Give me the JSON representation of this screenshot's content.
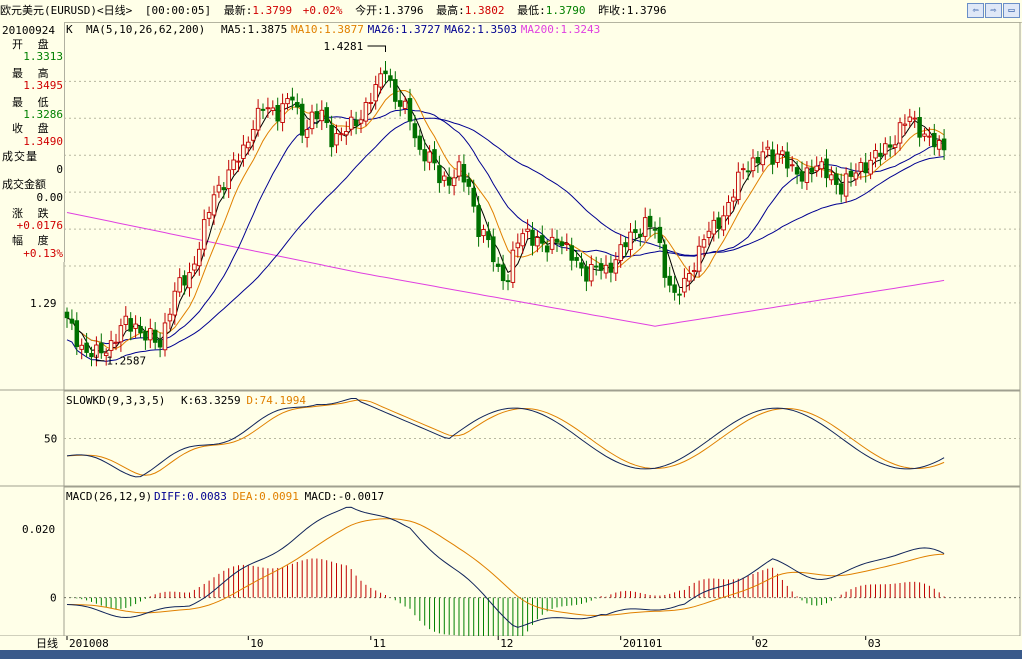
{
  "title": {
    "name": "欧元美元(EURUSD)<日线>",
    "time": "[00:00:05]",
    "latest_label": "最新:",
    "latest": "1.3799",
    "change": "+0.02%",
    "open_label": "今开:",
    "open": "1.3796",
    "high_label": "最高:",
    "high": "1.3802",
    "low_label": "最低:",
    "low": "1.3790",
    "prev_label": "昨收:",
    "prev": "1.3796"
  },
  "window_buttons": [
    "⇦",
    "⇨",
    "▭"
  ],
  "info_panel": {
    "date": "20100924",
    "items": [
      {
        "label": "开 盘",
        "value": "1.3313",
        "color": "#008000"
      },
      {
        "label": "最 高",
        "value": "1.3495",
        "color": "#d00000"
      },
      {
        "label": "最 低",
        "value": "1.3286",
        "color": "#008000"
      },
      {
        "label": "收 盘",
        "value": "1.3490",
        "color": "#d00000"
      },
      {
        "label": "成交量",
        "value": "0",
        "color": "#000000"
      },
      {
        "label": "成交金额",
        "value": "0.00",
        "color": "#000000"
      },
      {
        "label": "涨 跌",
        "value": "+0.0176",
        "color": "#d00000"
      },
      {
        "label": "幅 度",
        "value": "+0.13%",
        "color": "#d00000"
      }
    ]
  },
  "chart_data": [
    {
      "type": "candlestick",
      "legend": {
        "k": "K",
        "ma_params": "MA(5,10,26,62,200)",
        "entries": [
          {
            "name": "MA5",
            "text": "MA5:1.3875",
            "color": "#000000"
          },
          {
            "name": "MA10",
            "text": "MA10:1.3877",
            "color": "#e08000"
          },
          {
            "name": "MA26",
            "text": "MA26:1.3727",
            "color": "#000090"
          },
          {
            "name": "MA62",
            "text": "MA62:1.3503",
            "color": "#000090"
          },
          {
            "name": "MA200",
            "text": "MA200:1.3243",
            "color": "#e040e0"
          }
        ]
      },
      "y_ticks": [
        "1.29"
      ],
      "y_tick_values": [
        1.29
      ],
      "ylim": [
        1.245,
        1.44
      ],
      "annotations": [
        {
          "text": "1.4281",
          "value": 1.4281,
          "at": 1
        },
        {
          "text": "1.2587",
          "value": 1.2587,
          "at": 0
        }
      ],
      "anchors": [
        {
          "t": 0,
          "c": 1.28
        },
        {
          "t": 2,
          "c": 1.271
        },
        {
          "t": 4,
          "c": 1.263
        },
        {
          "t": 6,
          "c": 1.262
        },
        {
          "t": 9,
          "c": 1.268
        },
        {
          "t": 12,
          "c": 1.279
        },
        {
          "t": 14,
          "c": 1.278
        },
        {
          "t": 16,
          "c": 1.272
        },
        {
          "t": 19,
          "c": 1.268
        },
        {
          "t": 21,
          "c": 1.288
        },
        {
          "t": 23,
          "c": 1.3
        },
        {
          "t": 25,
          "c": 1.305
        },
        {
          "t": 28,
          "c": 1.33
        },
        {
          "t": 30,
          "c": 1.349
        },
        {
          "t": 33,
          "c": 1.36
        },
        {
          "t": 36,
          "c": 1.373
        },
        {
          "t": 38,
          "c": 1.387
        },
        {
          "t": 40,
          "c": 1.395
        },
        {
          "t": 43,
          "c": 1.394
        },
        {
          "t": 46,
          "c": 1.401
        },
        {
          "t": 48,
          "c": 1.384
        },
        {
          "t": 50,
          "c": 1.39
        },
        {
          "t": 52,
          "c": 1.392
        },
        {
          "t": 54,
          "c": 1.38
        },
        {
          "t": 56,
          "c": 1.381
        },
        {
          "t": 58,
          "c": 1.386
        },
        {
          "t": 60,
          "c": 1.392
        },
        {
          "t": 63,
          "c": 1.405
        },
        {
          "t": 65,
          "c": 1.419
        },
        {
          "t": 67,
          "c": 1.4
        },
        {
          "t": 70,
          "c": 1.391
        },
        {
          "t": 72,
          "c": 1.372
        },
        {
          "t": 74,
          "c": 1.368
        },
        {
          "t": 76,
          "c": 1.359
        },
        {
          "t": 78,
          "c": 1.356
        },
        {
          "t": 80,
          "c": 1.361
        },
        {
          "t": 82,
          "c": 1.354
        },
        {
          "t": 84,
          "c": 1.33
        },
        {
          "t": 86,
          "c": 1.322
        },
        {
          "t": 88,
          "c": 1.308
        },
        {
          "t": 90,
          "c": 1.303
        },
        {
          "t": 92,
          "c": 1.324
        },
        {
          "t": 94,
          "c": 1.33
        },
        {
          "t": 96,
          "c": 1.322
        },
        {
          "t": 98,
          "c": 1.319
        },
        {
          "t": 100,
          "c": 1.327
        },
        {
          "t": 102,
          "c": 1.318
        },
        {
          "t": 104,
          "c": 1.311
        },
        {
          "t": 106,
          "c": 1.307
        },
        {
          "t": 108,
          "c": 1.309
        },
        {
          "t": 110,
          "c": 1.307
        },
        {
          "t": 112,
          "c": 1.315
        },
        {
          "t": 114,
          "c": 1.322
        },
        {
          "t": 116,
          "c": 1.328
        },
        {
          "t": 118,
          "c": 1.334
        },
        {
          "t": 120,
          "c": 1.329
        },
        {
          "t": 122,
          "c": 1.308
        },
        {
          "t": 124,
          "c": 1.294
        },
        {
          "t": 126,
          "c": 1.299
        },
        {
          "t": 128,
          "c": 1.312
        },
        {
          "t": 130,
          "c": 1.326
        },
        {
          "t": 132,
          "c": 1.33
        },
        {
          "t": 134,
          "c": 1.338
        },
        {
          "t": 136,
          "c": 1.35
        },
        {
          "t": 138,
          "c": 1.362
        },
        {
          "t": 140,
          "c": 1.367
        },
        {
          "t": 142,
          "c": 1.371
        },
        {
          "t": 144,
          "c": 1.368
        },
        {
          "t": 146,
          "c": 1.373
        },
        {
          "t": 148,
          "c": 1.36
        },
        {
          "t": 150,
          "c": 1.358
        },
        {
          "t": 152,
          "c": 1.365
        },
        {
          "t": 154,
          "c": 1.362
        },
        {
          "t": 156,
          "c": 1.358
        },
        {
          "t": 158,
          "c": 1.353
        },
        {
          "t": 160,
          "c": 1.358
        },
        {
          "t": 162,
          "c": 1.364
        },
        {
          "t": 164,
          "c": 1.367
        },
        {
          "t": 166,
          "c": 1.371
        },
        {
          "t": 168,
          "c": 1.376
        },
        {
          "t": 170,
          "c": 1.384
        },
        {
          "t": 172,
          "c": 1.39
        },
        {
          "t": 174,
          "c": 1.385
        },
        {
          "t": 176,
          "c": 1.378
        },
        {
          "t": 178,
          "c": 1.374
        }
      ],
      "series_colors": {
        "up": "#c00000",
        "down": "#007000",
        "ma5": "#000000",
        "ma10": "#e08000",
        "ma26": "#000090",
        "ma62": "#000090",
        "ma200": "#e040e0"
      }
    },
    {
      "type": "line",
      "legend": {
        "name": "SLOWKD(9,3,3,5)",
        "entries": [
          {
            "name": "K",
            "text": "K:63.3259",
            "color": "#000000"
          },
          {
            "name": "D",
            "text": "D:74.1994",
            "color": "#e08000"
          }
        ]
      },
      "y_ticks": [
        "50"
      ],
      "y_tick_values": [
        50
      ],
      "ylim": [
        0,
        100
      ]
    },
    {
      "type": "bar",
      "legend": {
        "name": "MACD(26,12,9)",
        "entries": [
          {
            "name": "DIFF",
            "text": "DIFF:0.0083",
            "color": "#000090"
          },
          {
            "name": "DEA",
            "text": "DEA:0.0091",
            "color": "#e08000"
          },
          {
            "name": "MACD",
            "text": "MACD:-0.0017",
            "color": "#000000"
          }
        ]
      },
      "y_ticks": [
        "0.020",
        "0"
      ],
      "y_tick_values": [
        0.02,
        0
      ],
      "ylim": [
        -0.01,
        0.031
      ]
    }
  ],
  "x_axis": {
    "period_label": "日线",
    "labels": [
      {
        "text": "201008",
        "at": 0
      },
      {
        "text": "10",
        "at": 37
      },
      {
        "text": "11",
        "at": 62
      },
      {
        "text": "12",
        "at": 88
      },
      {
        "text": "201101",
        "at": 113
      },
      {
        "text": "02",
        "at": 140
      },
      {
        "text": "03",
        "at": 163
      }
    ]
  }
}
